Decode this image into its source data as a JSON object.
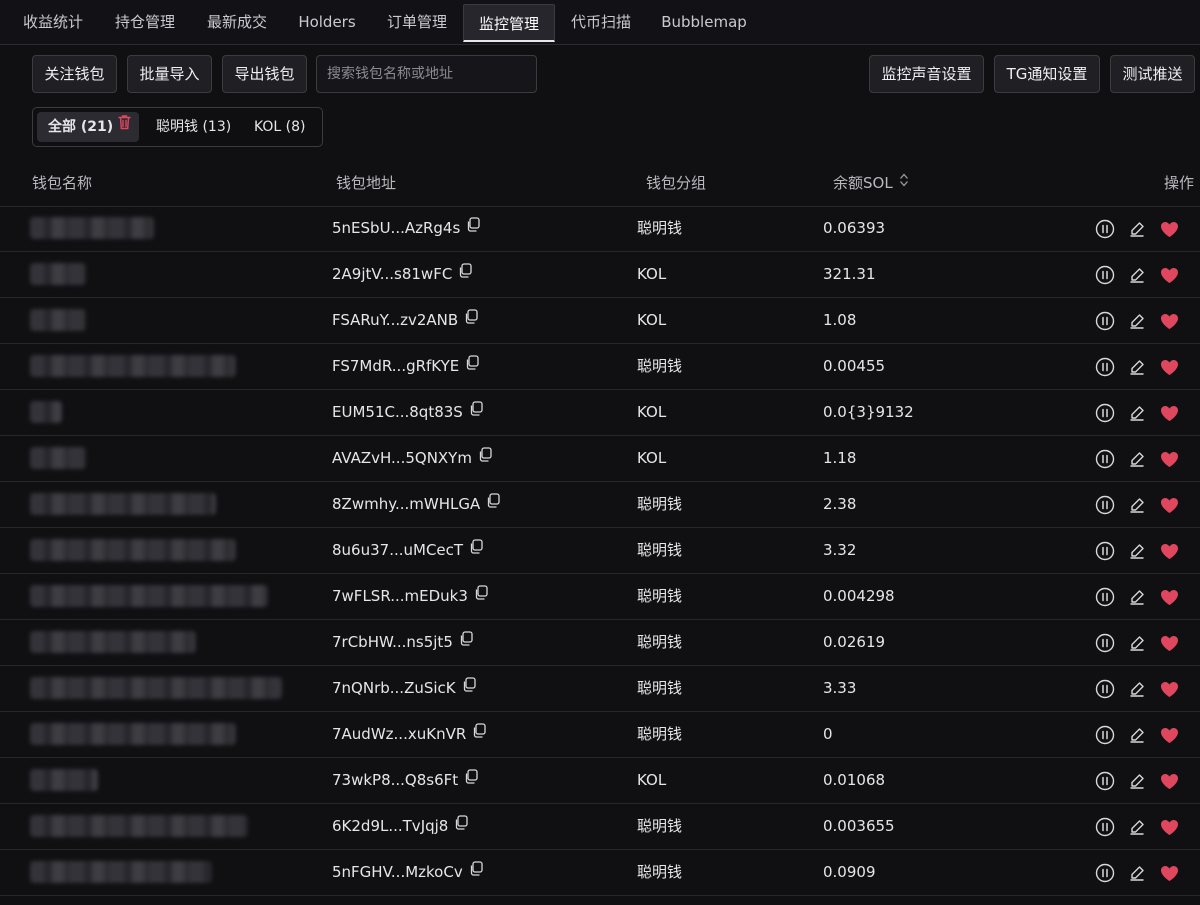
{
  "tabs": [
    {
      "label": "收益统计",
      "active": false
    },
    {
      "label": "持仓管理",
      "active": false
    },
    {
      "label": "最新成交",
      "active": false
    },
    {
      "label": "Holders",
      "active": false
    },
    {
      "label": "订单管理",
      "active": false
    },
    {
      "label": "监控管理",
      "active": true
    },
    {
      "label": "代币扫描",
      "active": false
    },
    {
      "label": "Bubblemap",
      "active": false
    }
  ],
  "toolbar": {
    "follow_label": "关注钱包",
    "import_label": "批量导入",
    "export_label": "导出钱包",
    "search_placeholder": "搜索钱包名称或地址",
    "sound_label": "监控声音设置",
    "tg_label": "TG通知设置",
    "test_label": "测试推送"
  },
  "filters": [
    {
      "label": "全部 (21)",
      "active": true
    },
    {
      "label": "聪明钱 (13)",
      "active": false
    },
    {
      "label": "KOL (8)",
      "active": false
    }
  ],
  "columns": {
    "name": "钱包名称",
    "address": "钱包地址",
    "group": "钱包分组",
    "balance": "余额SOL",
    "actions": "操作"
  },
  "colors": {
    "accent_heart": "#e0465e",
    "trash": "#e0465e"
  },
  "icons": {
    "row_actions": [
      "pause-icon",
      "edit-icon",
      "heart-icon"
    ],
    "copy": "copy-icon",
    "sort": "sort-icon",
    "trash": "trash-icon"
  },
  "rows": [
    {
      "address": "5nESbU...AzRg4s",
      "group": "聪明钱",
      "balance": "0.06393"
    },
    {
      "address": "2A9jtV...s81wFC",
      "group": "KOL",
      "balance": "321.31"
    },
    {
      "address": "FSARuY...zv2ANB",
      "group": "KOL",
      "balance": "1.08"
    },
    {
      "address": "FS7MdR...gRfKYE",
      "group": "聪明钱",
      "balance": "0.00455"
    },
    {
      "address": "EUM51C...8qt83S",
      "group": "KOL",
      "balance": "0.0{3}9132"
    },
    {
      "address": "AVAZvH...5QNXYm",
      "group": "KOL",
      "balance": "1.18"
    },
    {
      "address": "8Zwmhy...mWHLGA",
      "group": "聪明钱",
      "balance": "2.38"
    },
    {
      "address": "8u6u37...uMCecT",
      "group": "聪明钱",
      "balance": "3.32"
    },
    {
      "address": "7wFLSR...mEDuk3",
      "group": "聪明钱",
      "balance": "0.004298"
    },
    {
      "address": "7rCbHW...ns5jt5",
      "group": "聪明钱",
      "balance": "0.02619"
    },
    {
      "address": "7nQNrb...ZuSicK",
      "group": "聪明钱",
      "balance": "3.33"
    },
    {
      "address": "7AudWz...xuKnVR",
      "group": "聪明钱",
      "balance": "0"
    },
    {
      "address": "73wkP8...Q8s6Ft",
      "group": "KOL",
      "balance": "0.01068"
    },
    {
      "address": "6K2d9L...TvJqj8",
      "group": "聪明钱",
      "balance": "0.003655"
    },
    {
      "address": "5nFGHV...MzkoCv",
      "group": "聪明钱",
      "balance": "0.0909"
    }
  ]
}
